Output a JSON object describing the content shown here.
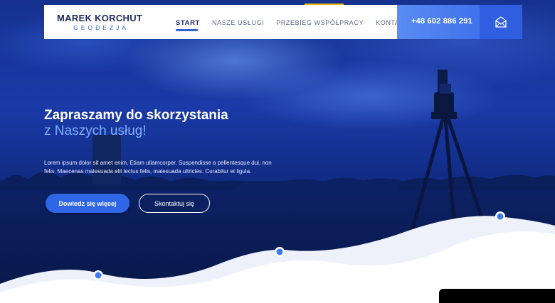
{
  "header": {
    "logo": {
      "name": "MAREK KORCHUT",
      "subtitle": "GEODEZJA"
    },
    "nav": [
      {
        "label": "START",
        "active": true
      },
      {
        "label": "NASZE USŁUGI",
        "active": false
      },
      {
        "label": "PRZEBIEG WSPÓŁPRACY",
        "active": false
      },
      {
        "label": "KONTAKT",
        "active": false
      }
    ],
    "phone": "+48 602 886 291",
    "mail_icon": "envelope-icon"
  },
  "hero": {
    "headline": "Zapraszamy do skorzystania",
    "subheadline": "z Naszych usług!",
    "paragraph": "Lorem ipsum dolor sit amet enim. Etiam ullamcorper. Suspendisse a pellentesque dui, non felis. Maecenas malesuada elit lectus felis, malesuada ultricies. Curabitur et ligula.",
    "primary_button": "Dowiedz się więcej",
    "secondary_button": "Skontaktuj się"
  },
  "colors": {
    "brand_blue": "#2f62d8",
    "accent_light_blue": "#7fb0ff",
    "accent_yellow": "#f2c200",
    "navy": "#1f2b5c"
  }
}
